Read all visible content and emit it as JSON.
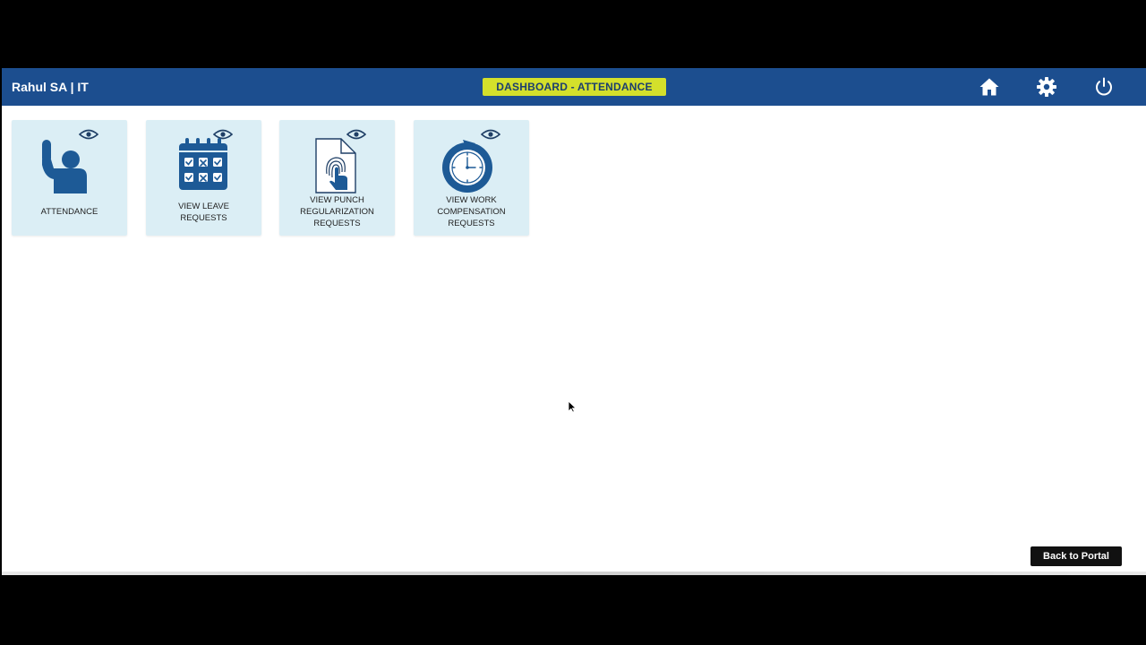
{
  "header": {
    "user": "Rahul SA | IT",
    "title": "DASHBOARD - ATTENDANCE",
    "icons": [
      "home-icon",
      "gear-icon",
      "power-icon"
    ],
    "color": "#1c4e8f",
    "badge_color": "#d4e02b"
  },
  "tiles": [
    {
      "label": "ATTENDANCE",
      "icon": "raised-hand-person-icon"
    },
    {
      "label": "VIEW LEAVE\nREQUESTS",
      "icon": "calendar-icon"
    },
    {
      "label": "VIEW PUNCH\nREGULARIZATION\nREQUESTS",
      "icon": "fingerprint-document-icon"
    },
    {
      "label": "VIEW WORK\nCOMPENSATION\nREQUESTS",
      "icon": "clock-icon"
    }
  ],
  "footer": {
    "back_label": "Back to Portal"
  }
}
